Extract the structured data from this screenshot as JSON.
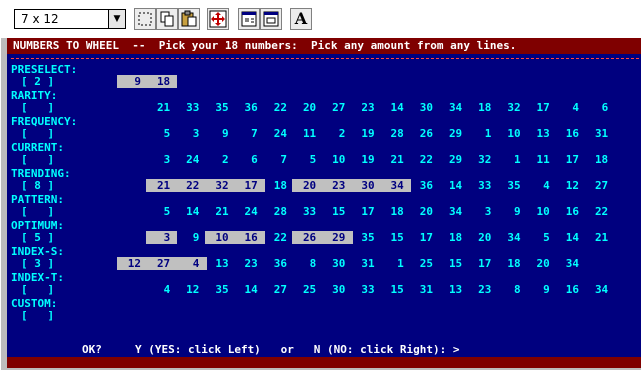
{
  "toolbar": {
    "font_size": "7 x 12",
    "letter_button": "A",
    "icons": [
      "mark-icon",
      "copy-icon",
      "paste-icon",
      "fullscreen-icon",
      "properties-icon",
      "background-icon",
      "font-icon"
    ]
  },
  "header": {
    "text": "NUMBERS TO WHEEL  --  Pick your 18 numbers:  Pick any amount from any lines."
  },
  "colors": {
    "background": "#00007f",
    "header_bar": "#7f0000",
    "label": "#00ffff",
    "number": "#00ffff",
    "highlight": "#c0c0c0",
    "highlight_text": "#000080"
  },
  "rows": [
    {
      "label": "PRESELECT:",
      "bracket": "[ 2 ]",
      "numbers": [
        "9",
        "18"
      ],
      "highlighted": [
        0,
        1
      ],
      "first_col": 0
    },
    {
      "label": "RARITY:",
      "bracket": "[   ]",
      "numbers": [
        "21",
        "33",
        "35",
        "36",
        "22",
        "20",
        "27",
        "23",
        "14",
        "30",
        "34",
        "18",
        "32",
        "17",
        "4",
        "6"
      ],
      "highlighted": [],
      "first_col": 1
    },
    {
      "label": "FREQUENCY:",
      "bracket": "[   ]",
      "numbers": [
        "5",
        "3",
        "9",
        "7",
        "24",
        "11",
        "2",
        "19",
        "28",
        "26",
        "29",
        "1",
        "10",
        "13",
        "16",
        "31"
      ],
      "highlighted": [],
      "first_col": 1
    },
    {
      "label": "CURRENT:",
      "bracket": "[   ]",
      "numbers": [
        "3",
        "24",
        "2",
        "6",
        "7",
        "5",
        "10",
        "19",
        "21",
        "22",
        "29",
        "32",
        "1",
        "11",
        "17",
        "18"
      ],
      "highlighted": [],
      "first_col": 1
    },
    {
      "label": "TRENDING:",
      "bracket": "[ 8 ]",
      "numbers": [
        "21",
        "22",
        "32",
        "17",
        "18",
        "20",
        "23",
        "30",
        "34",
        "36",
        "14",
        "33",
        "35",
        "4",
        "12",
        "27"
      ],
      "highlighted": [
        0,
        1,
        2,
        3,
        5,
        6,
        7,
        8
      ],
      "first_col": 1
    },
    {
      "label": "PATTERN:",
      "bracket": "[   ]",
      "numbers": [
        "5",
        "14",
        "21",
        "24",
        "28",
        "33",
        "15",
        "17",
        "18",
        "20",
        "34",
        "3",
        "9",
        "10",
        "16",
        "22"
      ],
      "highlighted": [],
      "first_col": 1
    },
    {
      "label": "OPTIMUM:",
      "bracket": "[ 5 ]",
      "numbers": [
        "3",
        "9",
        "10",
        "16",
        "22",
        "26",
        "29",
        "35",
        "15",
        "17",
        "18",
        "20",
        "34",
        "5",
        "14",
        "21"
      ],
      "highlighted": [
        0,
        2,
        3,
        5,
        6
      ],
      "first_col": 1
    },
    {
      "label": "INDEX-S:",
      "bracket": "[ 3 ]",
      "numbers": [
        "12",
        "27",
        "4",
        "13",
        "23",
        "36",
        "8",
        "30",
        "31",
        "1",
        "25",
        "15",
        "17",
        "18",
        "20",
        "34"
      ],
      "highlighted": [
        0,
        1,
        2
      ],
      "first_col": 0
    },
    {
      "label": "INDEX-T:",
      "bracket": "[   ]",
      "numbers": [
        "4",
        "12",
        "35",
        "14",
        "27",
        "25",
        "30",
        "33",
        "15",
        "31",
        "13",
        "23",
        "8",
        "9",
        "16",
        "34"
      ],
      "highlighted": [],
      "first_col": 1
    },
    {
      "label": "CUSTOM:",
      "bracket": "[   ]",
      "numbers": [],
      "highlighted": [],
      "first_col": 1
    }
  ],
  "prompt": "OK?     Y (YES: click Left)   or   N (NO: click Right): >"
}
